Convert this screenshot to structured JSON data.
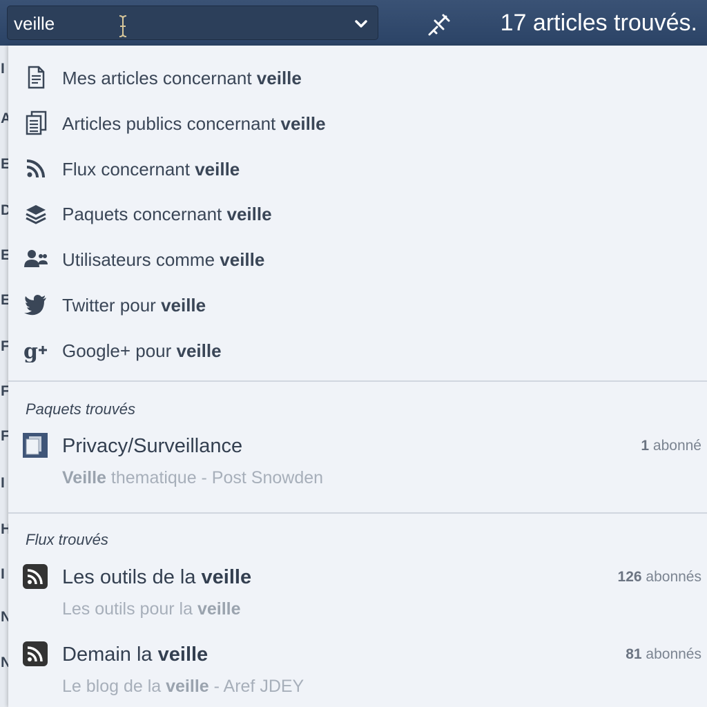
{
  "search": {
    "value": "veille",
    "result_count_text": "17 articles trouvés."
  },
  "left_edge_letters": [
    "I",
    "A",
    "E",
    "D",
    "E",
    "E",
    "F",
    "F",
    "F",
    "I",
    "H",
    "I",
    "N",
    "N"
  ],
  "actions": [
    {
      "icon": "document-icon",
      "prefix": "Mes articles concernant ",
      "term": "veille"
    },
    {
      "icon": "documents-stack-icon",
      "prefix": "Articles publics concernant ",
      "term": "veille"
    },
    {
      "icon": "rss-icon",
      "prefix": "Flux concernant ",
      "term": "veille"
    },
    {
      "icon": "layers-icon",
      "prefix": "Paquets concernant ",
      "term": "veille"
    },
    {
      "icon": "users-icon",
      "prefix": "Utilisateurs comme ",
      "term": "veille"
    },
    {
      "icon": "twitter-icon",
      "prefix": "Twitter pour ",
      "term": "veille"
    },
    {
      "icon": "google-plus-icon",
      "prefix": "Google+ pour ",
      "term": "veille"
    }
  ],
  "packages_section": {
    "heading": "Paquets trouvés",
    "items": [
      {
        "icon": "package-icon",
        "title": "Privacy/Surveillance",
        "sub_bold": "Veille",
        "sub_rest": " thematique - Post Snowden",
        "count": "1",
        "count_label": " abonné"
      }
    ]
  },
  "feeds_section": {
    "heading": "Flux trouvés",
    "items": [
      {
        "icon": "rss-feed-icon",
        "title_prefix": "Les outils de la ",
        "title_bold": "veille",
        "sub_prefix": "Les outils pour la ",
        "sub_bold": "veille",
        "sub_rest": "",
        "count": "126",
        "count_label": " abonnés"
      },
      {
        "icon": "rss-feed-icon",
        "title_prefix": "Demain la ",
        "title_bold": "veille",
        "sub_prefix": "Le blog de la ",
        "sub_bold": "veille",
        "sub_rest": " - Aref JDEY",
        "count": "81",
        "count_label": " abonnés"
      }
    ]
  }
}
